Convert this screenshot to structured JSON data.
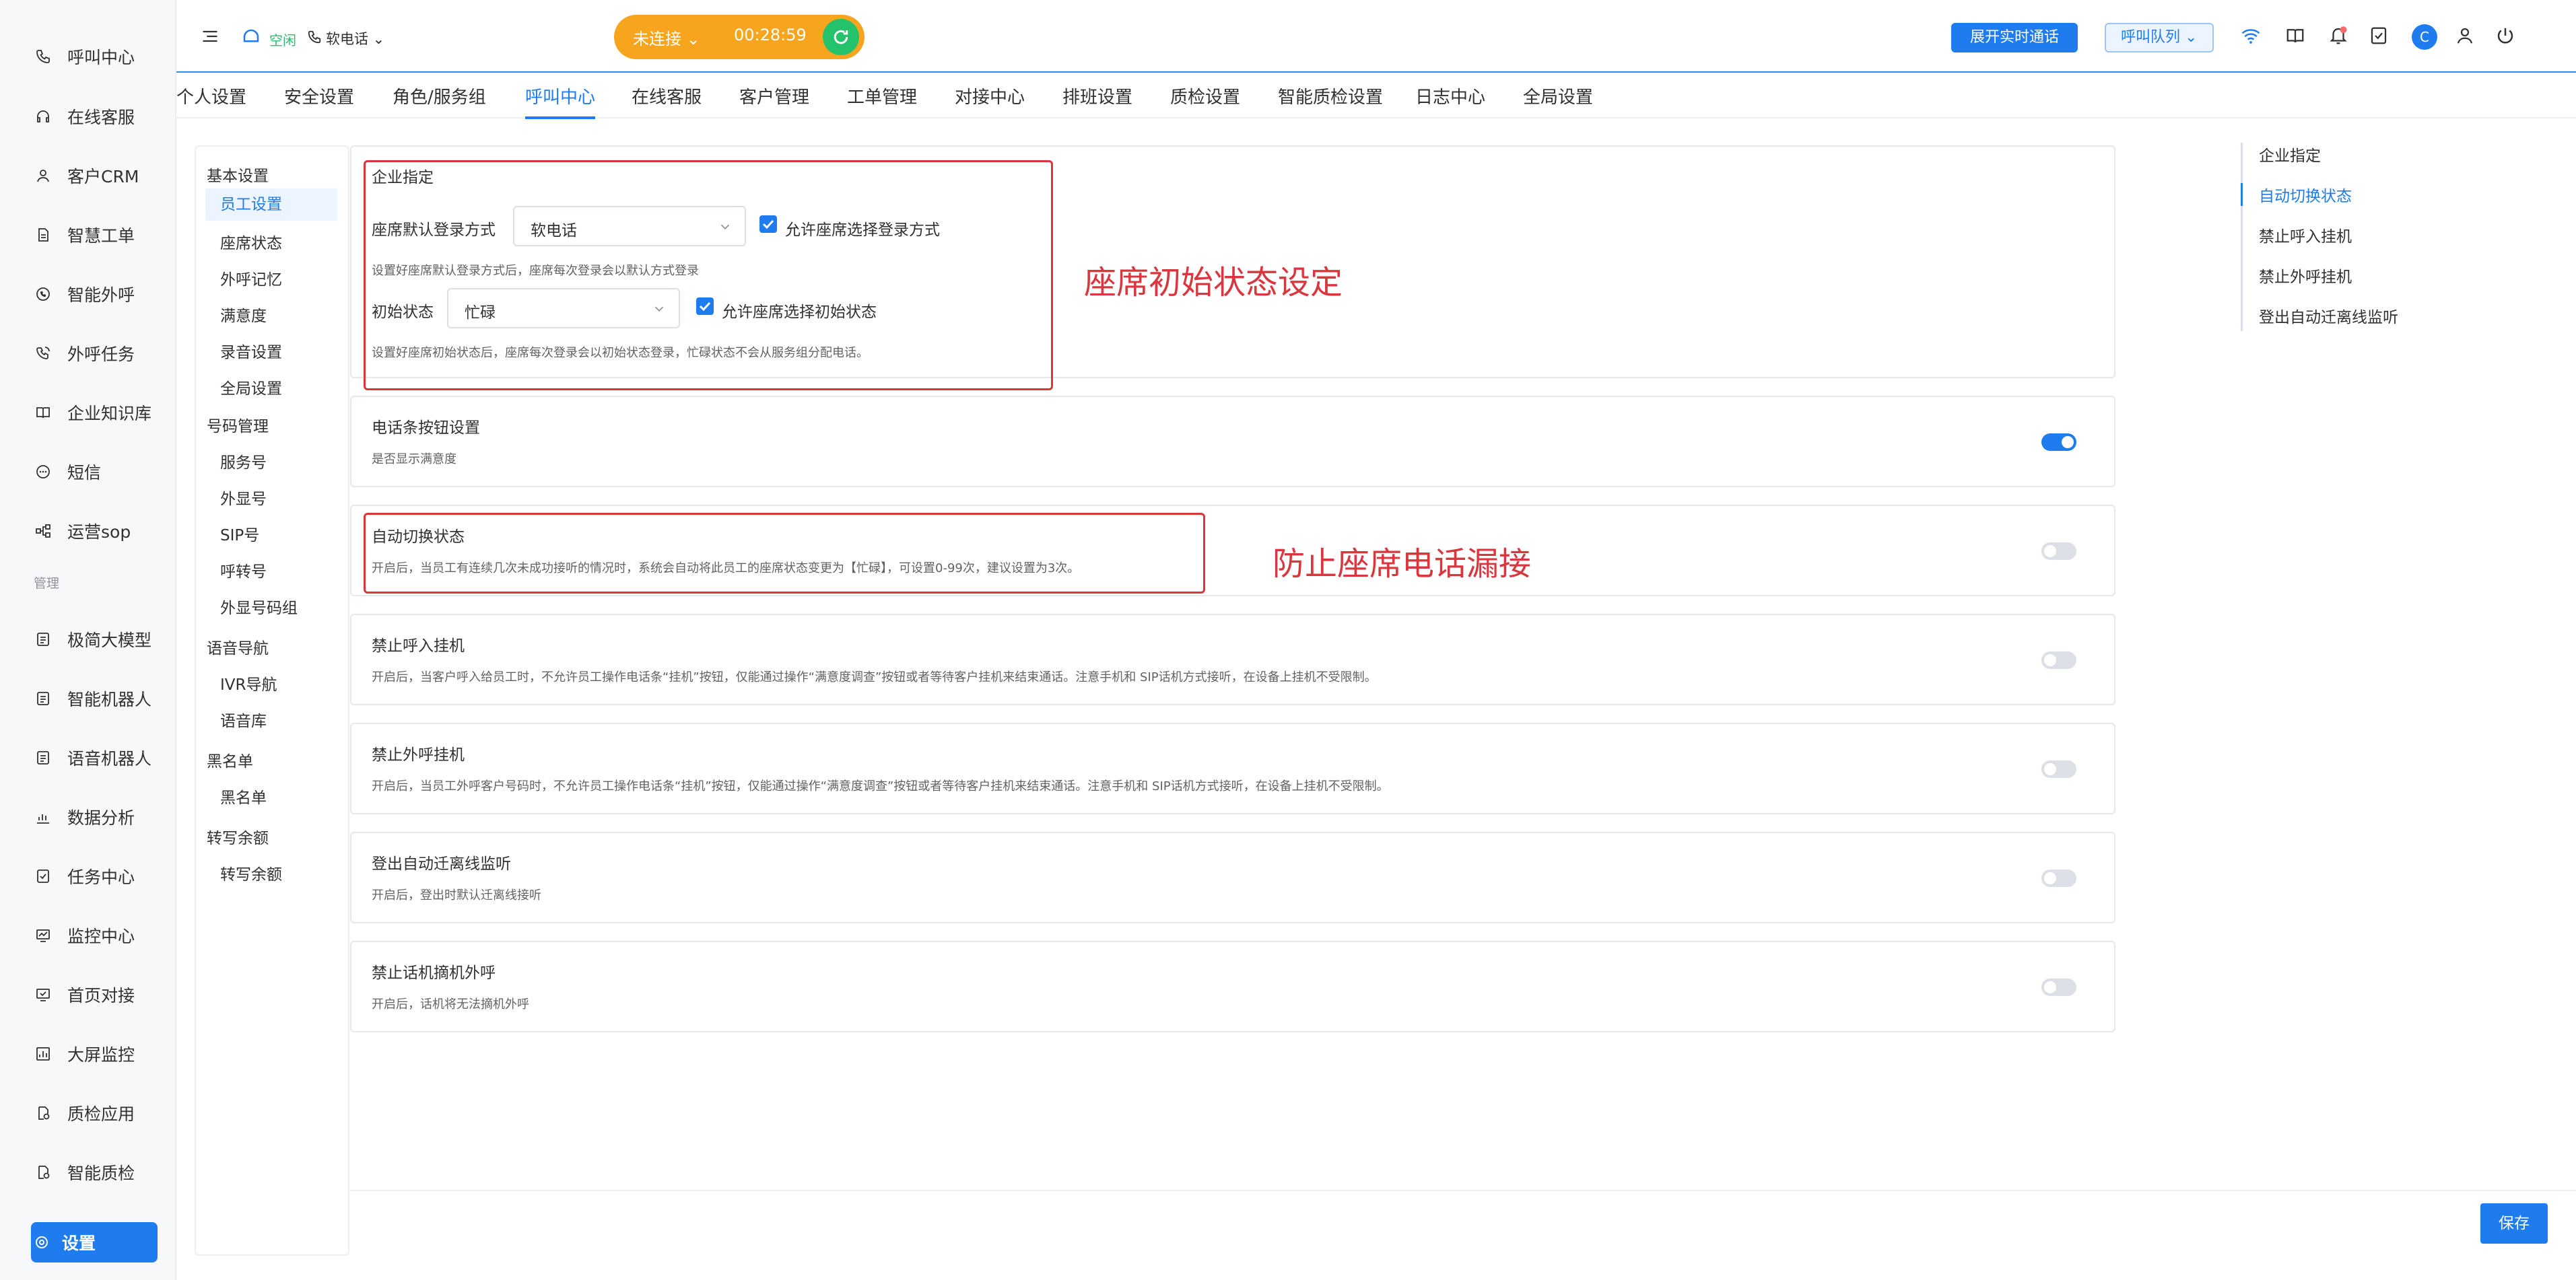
{
  "left_nav": {
    "items": [
      {
        "label": "呼叫中心",
        "icon": "phone-icon"
      },
      {
        "label": "在线客服",
        "icon": "headset-icon"
      },
      {
        "label": "客户CRM",
        "icon": "user-icon"
      },
      {
        "label": "智慧工单",
        "icon": "document-icon"
      },
      {
        "label": "智能外呼",
        "icon": "phone-call-icon"
      },
      {
        "label": "外呼任务",
        "icon": "phone-task-icon"
      },
      {
        "label": "企业知识库",
        "icon": "book-icon"
      },
      {
        "label": "短信",
        "icon": "message-icon"
      },
      {
        "label": "运营sop",
        "icon": "flow-icon"
      }
    ],
    "group_label": "管理",
    "items2": [
      {
        "label": "极简大模型",
        "icon": "model-icon"
      },
      {
        "label": "智能机器人",
        "icon": "robot-icon"
      },
      {
        "label": "语音机器人",
        "icon": "voice-robot-icon"
      },
      {
        "label": "数据分析",
        "icon": "chart-icon"
      },
      {
        "label": "任务中心",
        "icon": "task-icon"
      },
      {
        "label": "监控中心",
        "icon": "monitor-icon"
      },
      {
        "label": "首页对接",
        "icon": "home-link-icon"
      },
      {
        "label": "大屏监控",
        "icon": "screen-icon"
      },
      {
        "label": "质检应用",
        "icon": "check-app-icon"
      },
      {
        "label": "智能质检",
        "icon": "smart-check-icon"
      }
    ],
    "active": {
      "label": "设置",
      "icon": "settings-icon"
    }
  },
  "topbar": {
    "status_label": "空闲",
    "phone_mode": "软电话",
    "connection_status": "未连接",
    "timer": "00:28:59",
    "open_notice_button": "展开实时通话",
    "queue_button": "呼叫队列",
    "avatar_letter": "C"
  },
  "tabs": [
    "个人设置",
    "安全设置",
    "角色/服务组",
    "呼叫中心",
    "在线客服",
    "客户管理",
    "工单管理",
    "对接中心",
    "排班设置",
    "质检设置",
    "智能质检设置",
    "日志中心",
    "全局设置"
  ],
  "active_tab": "呼叫中心",
  "submenu": {
    "groups": [
      {
        "title": "基本设置",
        "items": [
          "员工设置",
          "座席状态",
          "外呼记忆",
          "满意度",
          "录音设置",
          "全局设置"
        ]
      },
      {
        "title": "号码管理",
        "items": [
          "服务号",
          "外显号",
          "SIP号",
          "呼转号",
          "外显号码组"
        ]
      },
      {
        "title": "语音导航",
        "items": [
          "IVR导航",
          "语音库"
        ]
      },
      {
        "title": "黑名单",
        "items": [
          "黑名单"
        ]
      },
      {
        "title": "转写余额",
        "items": [
          "转写余额"
        ]
      }
    ],
    "active_item": "员工设置"
  },
  "enterprise": {
    "title": "企业指定",
    "login_label": "座席默认登录方式",
    "login_value": "软电话",
    "login_allow": "允许座席选择登录方式",
    "login_hint": "设置好座席默认登录方式后，座席每次登录会以默认方式登录",
    "status_label": "初始状态",
    "status_value": "忙碌",
    "status_allow": "允许座席选择初始状态",
    "status_hint": "设置好座席初始状态后，座席每次登录会以初始状态登录，忙碌状态不会从服务组分配电话。"
  },
  "cards": [
    {
      "title": "电话条按钮设置",
      "desc": "是否显示满意度",
      "on": true
    },
    {
      "title": "自动切换状态",
      "desc": "开启后，当员工有连续几次未成功接听的情况时，系统会自动将此员工的座席状态变更为【忙碌】，可设置0-99次，建议设置为3次。",
      "on": false
    },
    {
      "title": "禁止呼入挂机",
      "desc": "开启后，当客户呼入给员工时，不允许员工操作电话条“挂机”按钮，仅能通过操作“满意度调查”按钮或者等待客户挂机来结束通话。注意手机和 SIP话机方式接听，在设备上挂机不受限制。",
      "on": false
    },
    {
      "title": "禁止外呼挂机",
      "desc": "开启后，当员工外呼客户号码时，不允许员工操作电话条“挂机”按钮，仅能通过操作“满意度调查”按钮或者等待客户挂机来结束通话。注意手机和 SIP话机方式接听，在设备上挂机不受限制。",
      "on": false
    },
    {
      "title": "登出自动迁离线监听",
      "desc": "开启后，登出时默认迁离线接听",
      "on": false
    },
    {
      "title": "禁止话机摘机外呼",
      "desc": "开启后，话机将无法摘机外呼",
      "on": false
    }
  ],
  "annotations": {
    "a1": "座席初始状态设定",
    "a2": "防止座席电话漏接"
  },
  "anchor": [
    "企业指定",
    "自动切换状态",
    "禁止呼入挂机",
    "禁止外呼挂机",
    "登出自动迁离线监听"
  ],
  "anchor_active": "自动切换状态",
  "save_button": "保存",
  "colors": {
    "primary": "#1f7cef",
    "annotation": "#d9363e",
    "warning": "#f7a41e",
    "success": "#24c26a"
  }
}
